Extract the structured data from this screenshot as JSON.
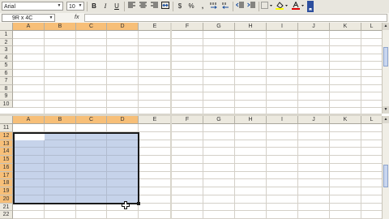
{
  "toolbar": {
    "font_name": "Arial",
    "font_size": "10",
    "bold": "B",
    "italic": "I",
    "underline": "U",
    "currency": "$",
    "percent": "%",
    "comma": ","
  },
  "formula_bar": {
    "name_box": "9R x 4C",
    "fx": "fx",
    "content": ""
  },
  "columns": [
    "A",
    "B",
    "C",
    "D",
    "E",
    "F",
    "G",
    "H",
    "I",
    "J",
    "K",
    "L"
  ],
  "rows_top": [
    "1",
    "2",
    "3",
    "4",
    "5",
    "6",
    "7",
    "8",
    "9",
    "10"
  ],
  "rows_bottom": [
    "11",
    "12",
    "13",
    "14",
    "15",
    "16",
    "17",
    "18",
    "19",
    "20",
    "21",
    "22"
  ],
  "selection": {
    "range": "A12:D20",
    "active_cell": "A12",
    "highlighted_columns": [
      "A",
      "B",
      "C",
      "D"
    ],
    "highlighted_rows": [
      "12",
      "13",
      "14",
      "15",
      "16",
      "17",
      "18",
      "19",
      "20"
    ]
  },
  "colors": {
    "header_bg": "#ece9df",
    "header_selected": "#f7bf78",
    "selection_fill": "#92aad6",
    "gridline": "#d4d0c8"
  }
}
